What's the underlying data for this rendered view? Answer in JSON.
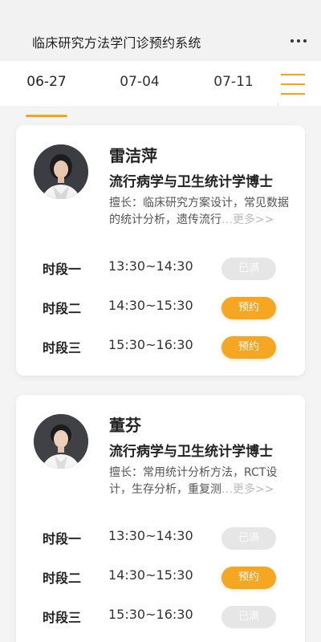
{
  "header": {
    "title": "临床研究方法学门诊预约系统",
    "more_icon": "more-horizontal-icon"
  },
  "tabs": [
    {
      "label": "06-27",
      "active": true
    },
    {
      "label": "07-04",
      "active": false
    },
    {
      "label": "07-11",
      "active": false
    }
  ],
  "menu_icon": "hamburger-menu-icon",
  "accent_color": "#f5a623",
  "doctors": [
    {
      "name": "雷洁萍",
      "title": "流行病学与卫生统计学博士",
      "expertise": "擅长：临床研究方案设计，常见数据的统计分析，遗传流行",
      "more": "…更多>>",
      "slots": [
        {
          "label": "时段一",
          "time": "13:30~14:30",
          "status": "已满",
          "available": false
        },
        {
          "label": "时段二",
          "time": "14:30~15:30",
          "status": "预约",
          "available": true
        },
        {
          "label": "时段三",
          "time": "15:30~16:30",
          "status": "预约",
          "available": true
        }
      ]
    },
    {
      "name": "董芬",
      "title": "流行病学与卫生统计学博士",
      "expertise": "擅长：常用统计分析方法，RCT设计，生存分析，重复测",
      "more": "…更多>>",
      "slots": [
        {
          "label": "时段一",
          "time": "13:30~14:30",
          "status": "已满",
          "available": false
        },
        {
          "label": "时段二",
          "time": "14:30~15:30",
          "status": "预约",
          "available": true
        },
        {
          "label": "时段三",
          "time": "15:30~16:30",
          "status": "已满",
          "available": false
        }
      ]
    }
  ]
}
